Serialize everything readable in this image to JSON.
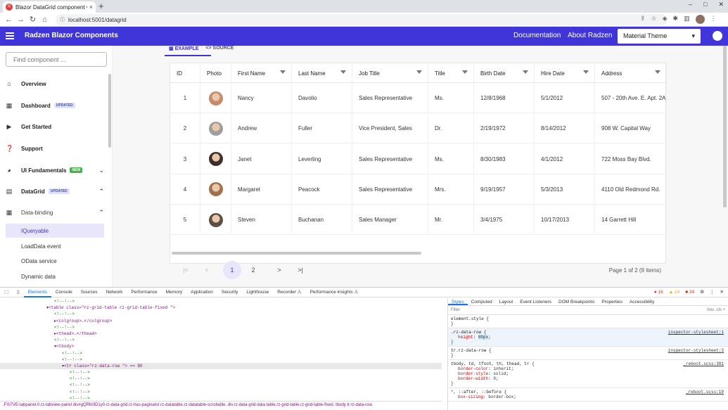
{
  "browser": {
    "tab_title": "Blazor DataGrid component w",
    "tab_favicon": "R",
    "tab_close": "×",
    "new_tab": "+",
    "url": "localhost:5001/datagrid",
    "win_min": "–",
    "win_max": "□",
    "win_close": "✕"
  },
  "app": {
    "title": "Radzen Blazor Components",
    "nav": [
      "Documentation",
      "About Radzen"
    ],
    "theme": "Material Theme"
  },
  "sidebar": {
    "search_placeholder": "Find component ...",
    "items": [
      {
        "label": "Overview",
        "icon": "home-icon"
      },
      {
        "label": "Dashboard",
        "badge": "UPDATED",
        "icon": "dashboard-icon"
      },
      {
        "label": "Get Started",
        "icon": "play-icon"
      },
      {
        "label": "Support",
        "icon": "help-icon"
      },
      {
        "label": "UI Fundamentals",
        "badge": "NEW",
        "icon": "palette-icon"
      },
      {
        "label": "DataGrid",
        "badge": "UPDATED",
        "icon": "grid-icon"
      }
    ],
    "sub_parent": "Data-binding",
    "sub_items": [
      "IQueryable",
      "LoadData event",
      "OData service",
      "Dynamic data"
    ],
    "selected": "IQueryable"
  },
  "main": {
    "tabs": [
      "EXAMPLE",
      "SOURCE"
    ],
    "active_tab": "EXAMPLE"
  },
  "grid": {
    "columns": [
      "ID",
      "Photo",
      "First Name",
      "Last Name",
      "Job Title",
      "Title",
      "Birth Date",
      "Hire Date",
      "Address"
    ],
    "rows": [
      {
        "id": "1",
        "first": "Nancy",
        "last": "Davolio",
        "job": "Sales Representative",
        "title": "Ms.",
        "birth": "12/8/1968",
        "hire": "5/1/2012",
        "address": "507 - 20th Ave. E. Apt. 2A",
        "photo_color": "#c48b6a"
      },
      {
        "id": "2",
        "first": "Andrew",
        "last": "Fuller",
        "job": "Vice President, Sales",
        "title": "Dr.",
        "birth": "2/19/1972",
        "hire": "8/14/2012",
        "address": "908 W. Capital Way",
        "photo_color": "#9e9e9e"
      },
      {
        "id": "3",
        "first": "Janet",
        "last": "Leverling",
        "job": "Sales Representative",
        "title": "Ms.",
        "birth": "8/30/1983",
        "hire": "4/1/2012",
        "address": "722 Moss Bay Blvd.",
        "photo_color": "#3e2f2a"
      },
      {
        "id": "4",
        "first": "Margaret",
        "last": "Peacock",
        "job": "Sales Representative",
        "title": "Mrs.",
        "birth": "9/19/1957",
        "hire": "5/3/2013",
        "address": "4110 Old Redmond Rd.",
        "photo_color": "#a0714f"
      },
      {
        "id": "5",
        "first": "Steven",
        "last": "Buchanan",
        "job": "Sales Manager",
        "title": "Mr.",
        "birth": "3/4/1975",
        "hire": "10/17/2013",
        "address": "14 Garrett Hill",
        "photo_color": "#5d4e46"
      }
    ],
    "pager": {
      "first": "|<",
      "prev": "<",
      "pages": [
        "1",
        "2"
      ],
      "current": "1",
      "next": ">",
      "last": ">|",
      "info": "Page 1 of 2 (9 items)"
    }
  },
  "devtools": {
    "tabs": [
      "Elements",
      "Console",
      "Sources",
      "Network",
      "Performance",
      "Memory",
      "Application",
      "Security",
      "Lighthouse",
      "Recorder ⚠",
      "Performance insights ⚠"
    ],
    "active_tab": "Elements",
    "errors": "16",
    "warnings": "14",
    "issues": "34",
    "dom_lines": [
      {
        "indent": 7,
        "text": "<!--!-->",
        "kind": "comment"
      },
      {
        "indent": 6,
        "text": "▾<table class=\"rz-grid-table rz-grid-table-fixed \">",
        "kind": "tag"
      },
      {
        "indent": 7,
        "text": "<!--!-->",
        "kind": "comment"
      },
      {
        "indent": 7,
        "text": "▸<colgroup>…</colgroup>",
        "kind": "tag"
      },
      {
        "indent": 7,
        "text": "<!--!-->",
        "kind": "comment"
      },
      {
        "indent": 7,
        "text": "▸<thead>…</thead>",
        "kind": "tag"
      },
      {
        "indent": 7,
        "text": "<!--!-->",
        "kind": "comment"
      },
      {
        "indent": 7,
        "text": "▾<tbody>",
        "kind": "tag"
      },
      {
        "indent": 8,
        "text": "<!--!-->",
        "kind": "comment"
      },
      {
        "indent": 8,
        "text": "<!--!-->",
        "kind": "comment"
      },
      {
        "indent": 8,
        "text": "▾<tr class=\"rz-data-row  \"> == $0",
        "kind": "tag",
        "highlight": true
      },
      {
        "indent": 9,
        "text": "<!--!-->",
        "kind": "comment"
      },
      {
        "indent": 9,
        "text": "<!--!-->",
        "kind": "comment"
      },
      {
        "indent": 9,
        "text": "<!--!-->",
        "kind": "comment"
      },
      {
        "indent": 9,
        "text": "<!--!-->",
        "kind": "comment"
      },
      {
        "indent": 9,
        "text": "<!--!-->",
        "kind": "comment"
      }
    ],
    "breadcrumbs": ".FXi7VE-tabpanel-0.rz-tabview-panel   div#gQRb0lD1y0.rz-data-grid.rz-has-paginator.rz-datatable.rz-datatable-scrollable.   div.rz-data-grid-data   table.rz-grid-table.rz-grid-table-fixed.   tbody   tr.rz-data-row.",
    "style_tabs": [
      "Styles",
      "Computed",
      "Layout",
      "Event Listeners",
      "DOM Breakpoints",
      "Properties",
      "Accessibility"
    ],
    "filter_placeholder": "Filter",
    "filter_tools": ":hov  .cls  +",
    "rules": [
      {
        "selector": "element.style {",
        "props": [],
        "close": "}",
        "source": ""
      },
      {
        "selector": ".rz-data-row {",
        "props": [
          {
            "name": "height",
            "value": "80px",
            "hl": true
          }
        ],
        "close": "}",
        "source": "inspector-stylesheet:1",
        "active": true
      },
      {
        "selector": "tr.rz-data-row {",
        "props": [],
        "close": "}",
        "source": "inspector-stylesheet:3"
      },
      {
        "selector": "tbody, td, tfoot, th, thead, tr {",
        "props": [
          {
            "name": "border-color",
            "value": "inherit"
          },
          {
            "name": "border-style",
            "value": "solid"
          },
          {
            "name": "border-width",
            "value": "0"
          }
        ],
        "close": "}",
        "source": "_reboot.scss:381"
      },
      {
        "selector": "*, ::after, ::before {",
        "props": [
          {
            "name": "box-sizing",
            "value": "border-box"
          }
        ],
        "close": "",
        "source": "_reboot.scss:19"
      }
    ]
  }
}
